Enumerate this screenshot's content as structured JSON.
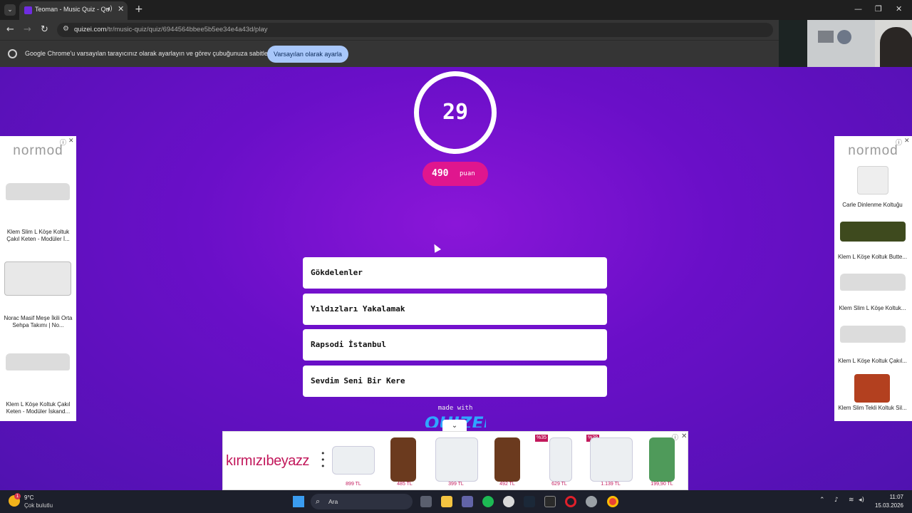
{
  "browser": {
    "tab_title": "Teoman - Music Quiz - Quiz",
    "url_host": "quizei.com",
    "url_path": "/tr/music-quiz/quiz/6944564bbee5b5ee34e4a43d/play",
    "infobar_text": "Google Chrome'u varsayılan tarayıcınız olarak ayarlayın ve görev çubuğunuza sabitleyin",
    "infobar_button": "Varsayılan olarak ayarla"
  },
  "quiz": {
    "timer": "29",
    "score": "490",
    "score_label": "puan",
    "answers": [
      "Gökdelenler",
      "Yıldızları Yakalamak",
      "Rapsodi İstanbul",
      "Sevdim Seni Bir Kere"
    ],
    "made_with": "made with",
    "logo": "QUIZEI"
  },
  "left_ad": {
    "brand": "normod",
    "items": [
      "Klem Slim L Köşe Koltuk Çakıl Keten - Modüler İ...",
      "Norac Masif Meşe İkili Orta Sehpa Takımı | No...",
      "Klem L Köşe Koltuk Çakıl Keten - Modüler İskand..."
    ]
  },
  "right_ad": {
    "brand": "normod",
    "items": [
      "Carle Dinlenme Koltuğu",
      "Klem L Köşe Koltuk Butte...",
      "Klem Slim L Köşe Koltuk...",
      "Klem L Köşe Koltuk Çakıl...",
      "Klem Slim Tekli Koltuk Sil..."
    ]
  },
  "bottom_ad": {
    "brand": "kırmızıbeyazz",
    "prices": [
      "899 TL",
      "485 TL",
      "399 TL",
      "492 TL",
      "629 TL",
      "1.139 TL",
      "199,90 TL"
    ],
    "discounts": [
      "%35",
      "%29"
    ]
  },
  "taskbar": {
    "weather_temp": "9°C",
    "weather_status": "Çok bulutlu",
    "weather_badge": "1",
    "search_placeholder": "Ara",
    "time": "11:07",
    "date": "15.03.2026"
  },
  "colors": {
    "page_purple": "#6a0fc8",
    "score_pink": "#e0168e",
    "infobar_button": "#a8c7fa"
  }
}
